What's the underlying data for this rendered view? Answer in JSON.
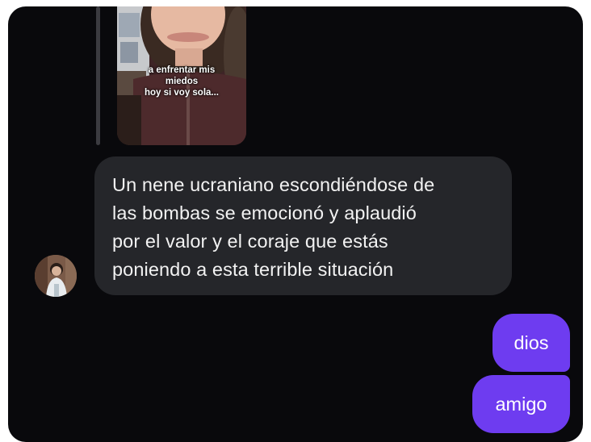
{
  "story_reply": {
    "caption_lines": [
      "a enfrentar mis",
      "miedos",
      "hoy si voy sola..."
    ]
  },
  "incoming_message": {
    "lines": [
      "Un nene ucraniano escondiéndose de",
      "las bombas se emocionó y aplaudió",
      "por el valor y el coraje que estás",
      "poniendo a esta terrible situación"
    ]
  },
  "outgoing_messages": [
    "dios",
    "amigo"
  ],
  "colors": {
    "background": "#09090c",
    "incoming_bubble": "#25262a",
    "outgoing_bubble": "#6e3cf0",
    "reply_line": "#3b3b40"
  },
  "icons": {
    "avatar": "sender-avatar-photo"
  }
}
